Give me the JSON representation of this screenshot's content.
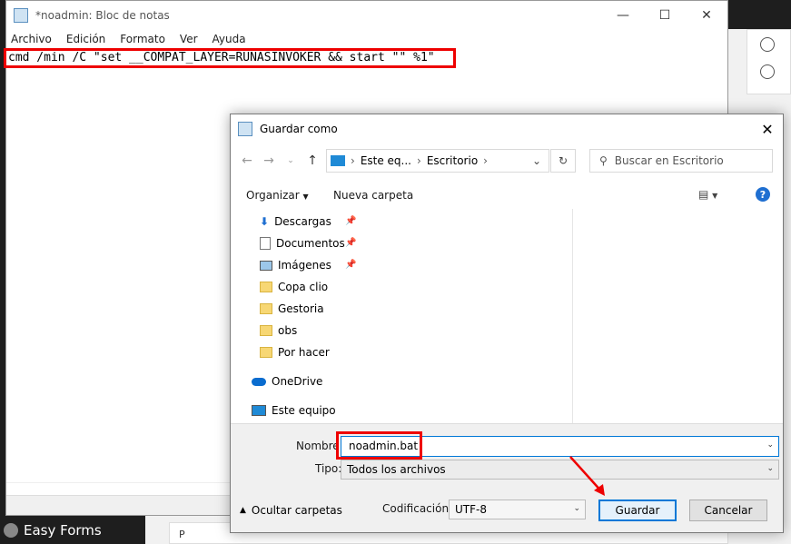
{
  "notepad": {
    "title": "*noadmin: Bloc de notas",
    "menu": [
      "Archivo",
      "Edición",
      "Formato",
      "Ver",
      "Ayuda"
    ],
    "content": "cmd /min /C \"set __COMPAT_LAYER=RUNASINVOKER && start \"\" %1\"",
    "controls": {
      "minimize": "—",
      "maximize": "☐",
      "close": "✕"
    }
  },
  "background": {
    "taskbar_label": "Easy Forms",
    "bottom_text": "P"
  },
  "dialog": {
    "title": "Guardar como",
    "breadcrumb": [
      "Este eq...",
      "Escritorio"
    ],
    "search_placeholder": "Buscar en Escritorio",
    "toolbar": {
      "organize": "Organizar",
      "new_folder": "Nueva carpeta",
      "help": "?"
    },
    "nav_items": [
      {
        "label": "Descargas",
        "icon": "download-icon",
        "pinned": true
      },
      {
        "label": "Documentos",
        "icon": "document-icon",
        "pinned": true
      },
      {
        "label": "Imágenes",
        "icon": "pictures-icon",
        "pinned": true
      },
      {
        "label": "Copa clio",
        "icon": "folder-icon",
        "pinned": false
      },
      {
        "label": "Gestoria",
        "icon": "folder-icon",
        "pinned": false
      },
      {
        "label": "obs",
        "icon": "folder-icon",
        "pinned": false
      },
      {
        "label": "Por hacer",
        "icon": "folder-icon",
        "pinned": false
      },
      {
        "label": "OneDrive",
        "icon": "onedrive-icon",
        "pinned": false
      },
      {
        "label": "Este equipo",
        "icon": "computer-icon",
        "pinned": false
      }
    ],
    "filename_label": "Nombre:",
    "filename_value": "noadmin.bat",
    "type_label": "Tipo:",
    "type_value": "Todos los archivos",
    "encoding_label": "Codificación:",
    "encoding_value": "UTF-8",
    "save_button": "Guardar",
    "cancel_button": "Cancelar",
    "hide_folders": "Ocultar carpetas"
  },
  "colors": {
    "highlight": "#e00000",
    "accent": "#0078d7"
  }
}
